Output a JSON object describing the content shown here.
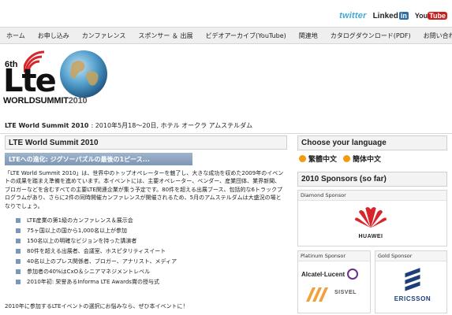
{
  "social": {
    "twitter": "twitter",
    "linkedin": "Linked",
    "linkedin_in": "in",
    "youtube_you": "You",
    "youtube_tube": "Tube"
  },
  "nav": {
    "items": [
      "ホーム",
      "お申し込み",
      "カンファレンス",
      "スポンサー ＆ 出展",
      "ビデオアーカイブ(YouTube)",
      "関連地",
      "カタログダウンロード(PDF)",
      "お問い合わせ"
    ]
  },
  "logo": {
    "sixth": "6th",
    "lte": "Lte",
    "world": "WORLDSUMMIT",
    "year": "2010"
  },
  "event": {
    "name": "LTE World Summit 2010",
    "details": ": 2010年5月18〜20日, ホテル オークラ アムステルダム"
  },
  "main": {
    "title": "LTE World Summit 2010",
    "subtitle": "LTEへの進化: ジグソーパズルの最後の1ピース...",
    "intro": "「LTE World Summit 2010」は、世界中のトップオペレーターを魅了し、大きな成功を収めた2009年のイベントの成果を踏まえ準備を進めています。本イベントには、主要オペレーター、ベンダー、産業団体、業界新聞、ブロガーなどを含むすべての主要LTE関連企業が集う予定です。80件を超える出展ブース、包括的な6トラックプログラムがあり、さらに2件の同時開催カンファレンスが開催されるため、5月のアムステルダムは大盛況の場となりでしょう。",
    "bullets": [
      "LTE産業の第1級のカンファレンス＆展示会",
      "75ヶ国以上の国から1,000名以上が参加",
      "150名以上の明確なビジョンを持った講演者",
      "80件を超える出展者、会議室、ホスピタリティスイート",
      "40名以上のプレス関係者、ブロガー、アナリスト、メディア",
      "参加者の40%はCxO＆シニアマネジメントレベル",
      "2010年初: 栄誉あるInforma LTE Awards賞の授与式"
    ],
    "cta": "2010年に参加するLTEイベントの選択にお悩みなら、ぜひ本イベントに！"
  },
  "sidebar": {
    "language_title": "Choose your language",
    "languages": [
      "繁體中文",
      "簡体中文"
    ],
    "sponsors_title": "2010 Sponsors (so far)",
    "diamond_label": "Diamond Sponsor",
    "diamond_name": "HUAWEI",
    "platinum_label": "Platinum Sponsor",
    "platinum_names": [
      "Alcatel·Lucent",
      "SISVEL"
    ],
    "gold_label": "Gold Sponsor",
    "gold_name": "ERICSSON"
  },
  "colors": {
    "nav_bg": "#efefef",
    "subtitle_bg": "#8ba2bf",
    "bullet": "#7a96b8",
    "lang_dot": "#f29b12",
    "huawei_red": "#d8252c",
    "ericsson_blue": "#1c3f7a",
    "alcatel_purple": "#6b2f8f"
  }
}
